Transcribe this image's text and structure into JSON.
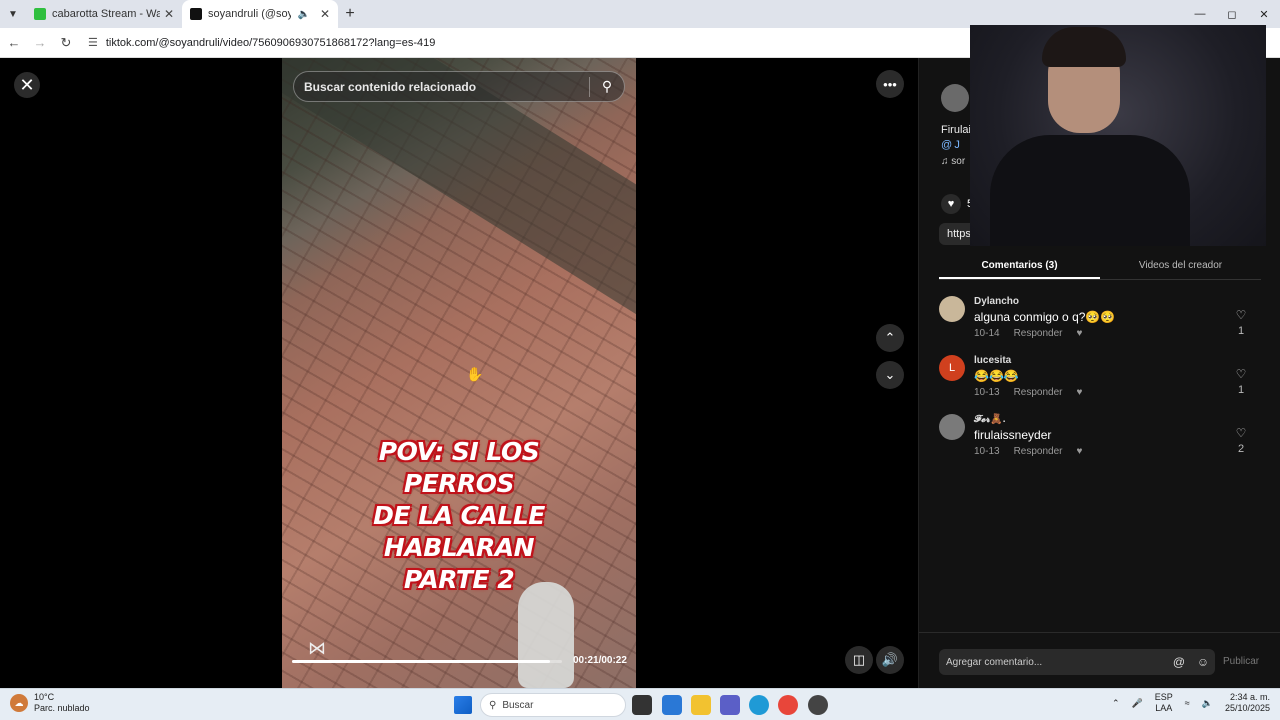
{
  "browser": {
    "tabs": [
      {
        "title": "cabarotta Stream - Watch Live o",
        "favicon_color": "#2fbf3f"
      },
      {
        "title": "soyandruli (@soyandruli) | T",
        "favicon_color": "#111111",
        "active": true
      }
    ],
    "new_tab": "+",
    "url": "tiktok.com/@soyandruli/video/7560906930751868172?lang=es-419"
  },
  "video": {
    "search_placeholder": "Buscar contenido relacionado",
    "caption_lines": [
      "POV: SI LOS PERROS",
      "DE LA CALLE HABLARAN",
      "PARTE 2"
    ],
    "time": "00:21/00:22",
    "progress": 0.955
  },
  "panel": {
    "desc_name": "Firulai",
    "desc_tag": "@ J",
    "music": "♫ sor",
    "likes": "5",
    "link": "https",
    "tabs": {
      "comments": "Comentarios (3)",
      "creator_videos": "Videos del creador"
    },
    "comments": [
      {
        "user": "Dylancho",
        "text": "alguna conmigo o q?🥺🥺",
        "date": "10-14",
        "reply": "Responder",
        "likes": "1",
        "avatar_color": "#c9b79a",
        "avatar_letter": ""
      },
      {
        "user": "lucesita",
        "text": "😂😂😂",
        "date": "10-13",
        "reply": "Responder",
        "likes": "1",
        "avatar_color": "#d0401e",
        "avatar_letter": "L"
      },
      {
        "user": "𝓕𝓮𝓻🧸.",
        "text": "firulaissneyder",
        "date": "10-13",
        "reply": "Responder",
        "likes": "2",
        "avatar_color": "#7a7a7a",
        "avatar_letter": ""
      }
    ],
    "comment_placeholder": "Agregar comentario...",
    "publish": "Publicar"
  },
  "taskbar": {
    "temp": "10°C",
    "weather": "Parc. nublado",
    "search": "Buscar",
    "lang_top": "ESP",
    "lang_bottom": "LAA",
    "time": "2:34 a. m.",
    "date": "25/10/2025"
  }
}
